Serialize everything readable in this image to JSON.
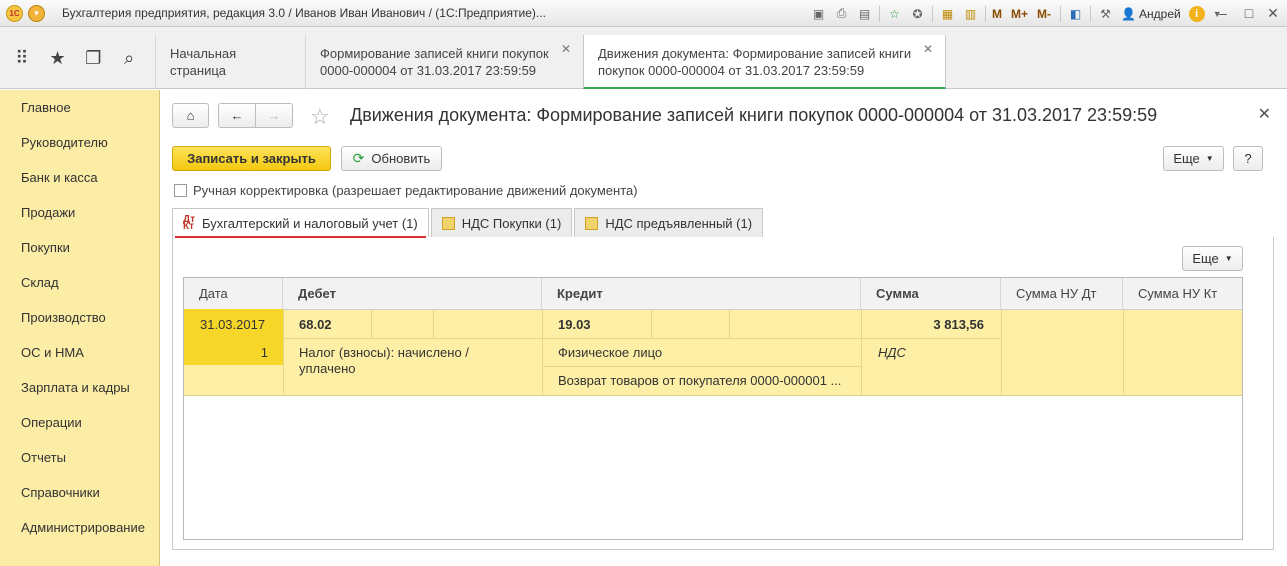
{
  "app": {
    "title": "Бухгалтерия предприятия, редакция 3.0 / Иванов Иван Иванович / (1С:Предприятие)...",
    "platform": "(1С:Предприятие)",
    "user": "Андрей",
    "m_buttons": [
      "M",
      "M+",
      "M-"
    ]
  },
  "tabs": [
    {
      "label": "Начальная страница"
    },
    {
      "label": "Формирование записей книги покупок 0000-000004 от 31.03.2017 23:59:59"
    },
    {
      "label": "Движения документа: Формирование записей книги покупок 0000-000004 от 31.03.2017 23:59:59"
    }
  ],
  "sidebar": {
    "items": [
      {
        "label": "Главное"
      },
      {
        "label": "Руководителю"
      },
      {
        "label": "Банк и касса"
      },
      {
        "label": "Продажи"
      },
      {
        "label": "Покупки"
      },
      {
        "label": "Склад"
      },
      {
        "label": "Производство"
      },
      {
        "label": "ОС и НМА"
      },
      {
        "label": "Зарплата и кадры"
      },
      {
        "label": "Операции"
      },
      {
        "label": "Отчеты"
      },
      {
        "label": "Справочники"
      },
      {
        "label": "Администрирование"
      }
    ]
  },
  "form": {
    "title": "Движения документа: Формирование записей книги покупок 0000-000004 от 31.03.2017 23:59:59",
    "save_close": "Записать и закрыть",
    "refresh": "Обновить",
    "more": "Еще",
    "help": "?",
    "manual_edit": "Ручная корректировка (разрешает редактирование движений документа)",
    "manual_edit_checked": false
  },
  "sub_tabs": [
    {
      "label": "Бухгалтерский и налоговый учет (1)",
      "icon": "dt-kt-icon"
    },
    {
      "label": "НДС Покупки (1)",
      "icon": "register-icon"
    },
    {
      "label": "НДС предъявленный (1)",
      "icon": "register-icon"
    }
  ],
  "grid": {
    "more": "Еще",
    "columns": [
      "Дата",
      "Дебет",
      "Кредит",
      "Сумма",
      "Сумма НУ Дт",
      "Сумма НУ Кт"
    ],
    "rows": [
      {
        "date": "31.03.2017",
        "line_no": "1",
        "debit_account": "68.02",
        "debit_subconto": "Налог (взносы): начислено / уплачено",
        "credit_account": "19.03",
        "credit_subconto1": "Физическое лицо",
        "credit_subconto2": "Возврат товаров от покупателя 0000-000001 ...",
        "amount": "3 813,56",
        "content": "НДС"
      }
    ]
  },
  "colors": {
    "sidebar_bg": "#fbeca6",
    "primary_button": "#f3c80f",
    "selected_row": "#fdf0a6",
    "active_tab_underline": "#3aa853",
    "subtab_underline": "#e03030"
  }
}
